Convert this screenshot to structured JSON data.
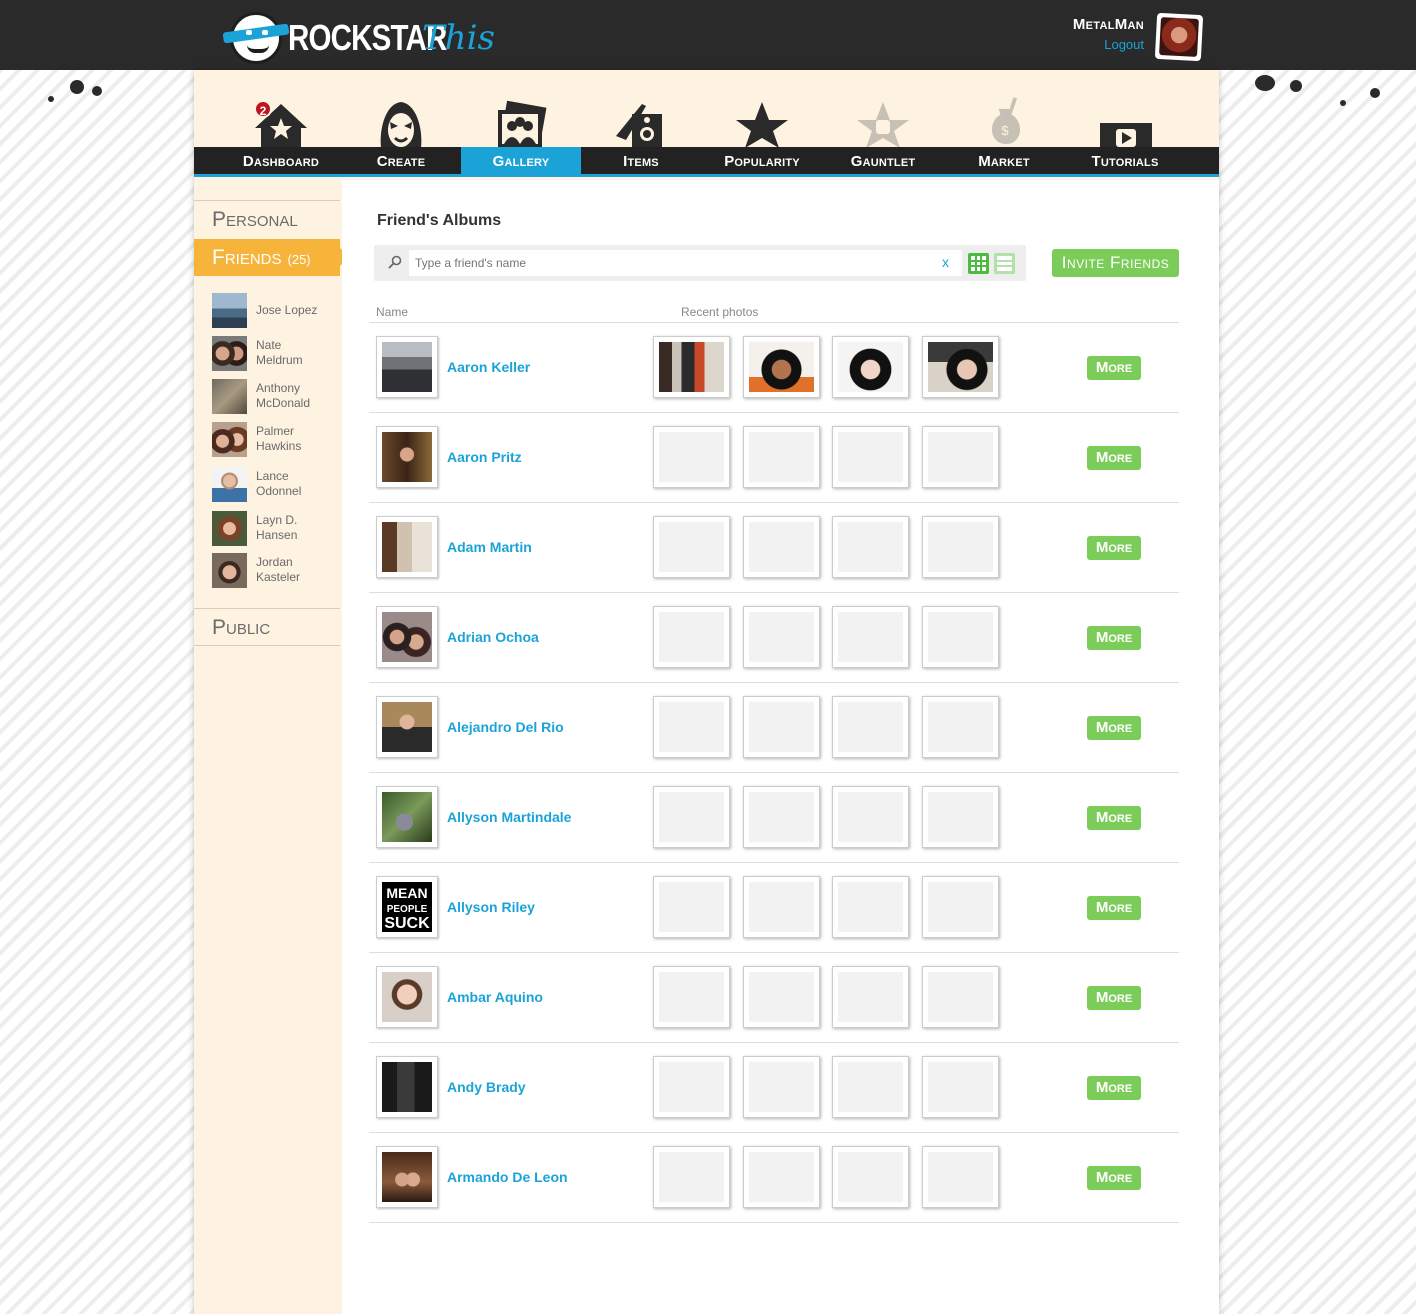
{
  "header": {
    "logo_main": "ROCKSTAR",
    "logo_accent": "This",
    "username": "MetalMan",
    "logout": "Logout"
  },
  "nav": {
    "items": [
      {
        "label": "Dashboard",
        "icon": "house-star-icon",
        "badge": "2"
      },
      {
        "label": "Create",
        "icon": "rocker-face-icon"
      },
      {
        "label": "Gallery",
        "icon": "photos-icon",
        "active": true
      },
      {
        "label": "Items",
        "icon": "guitar-amp-icon"
      },
      {
        "label": "Popularity",
        "icon": "star-icon"
      },
      {
        "label": "Gauntlet",
        "icon": "fist-star-icon"
      },
      {
        "label": "Market",
        "icon": "money-bag-icon"
      },
      {
        "label": "Tutorials",
        "icon": "play-icon"
      }
    ]
  },
  "sidebar": {
    "personal": "Personal",
    "friends": "Friends",
    "friends_count": "(25)",
    "public": "Public",
    "friends_list": [
      {
        "line1": "Jose Lopez",
        "line2": ""
      },
      {
        "line1": "Nate",
        "line2": "Meldrum"
      },
      {
        "line1": "Anthony",
        "line2": "McDonald"
      },
      {
        "line1": "Palmer",
        "line2": "Hawkins"
      },
      {
        "line1": "Lance",
        "line2": "Odonnel"
      },
      {
        "line1": "Layn D.",
        "line2": "Hansen"
      },
      {
        "line1": "Jordan",
        "line2": "Kasteler"
      }
    ]
  },
  "content": {
    "title": "Friend's Albums",
    "search_placeholder": "Type a friend's name",
    "clear": "x",
    "invite": "Invite Friends",
    "col_name": "Name",
    "col_recent": "Recent photos",
    "more_label": "More",
    "rows": [
      {
        "name": "Aaron Keller"
      },
      {
        "name": "Aaron Pritz"
      },
      {
        "name": "Adam Martin"
      },
      {
        "name": "Adrian Ochoa"
      },
      {
        "name": "Alejandro Del Rio"
      },
      {
        "name": "Allyson Martindale"
      },
      {
        "name": "Allyson Riley"
      },
      {
        "name": "Ambar Aquino"
      },
      {
        "name": "Andy Brady"
      },
      {
        "name": "Armando De Leon"
      }
    ]
  },
  "colors": {
    "accent_blue": "#1ba3d8",
    "accent_orange": "#f6b43a",
    "accent_green": "#7ccc5a",
    "header_dark": "#2a2a2a",
    "panel_cream": "#fef3e0"
  }
}
